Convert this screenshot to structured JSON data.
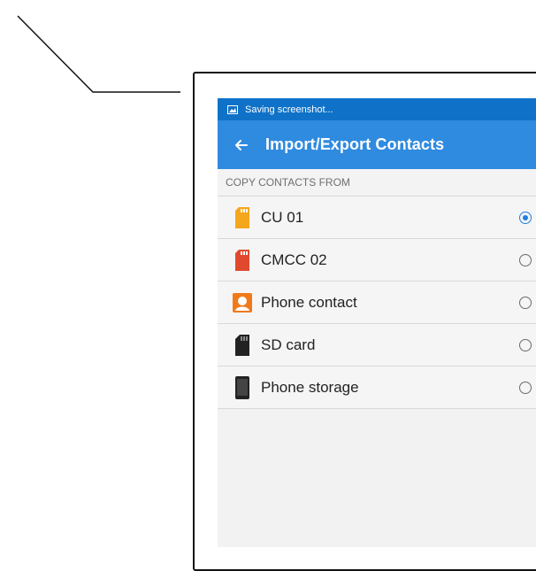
{
  "status_bar": {
    "text": "Saving screenshot..."
  },
  "app_bar": {
    "title": "Import/Export Contacts"
  },
  "section": {
    "title": "COPY CONTACTS FROM"
  },
  "items": [
    {
      "label": "CU 01",
      "icon": "sim-card-yellow-icon",
      "selected": true
    },
    {
      "label": "CMCC 02",
      "icon": "sim-card-red-icon",
      "selected": false
    },
    {
      "label": "Phone contact",
      "icon": "contact-avatar-icon",
      "selected": false
    },
    {
      "label": "SD card",
      "icon": "sd-card-icon",
      "selected": false
    },
    {
      "label": "Phone storage",
      "icon": "phone-storage-icon",
      "selected": false
    }
  ],
  "colors": {
    "status_bar": "#0f72c8",
    "app_bar": "#2f8be0",
    "radio_selected": "#1f7ee0",
    "sim_yellow": "#f4a61c",
    "sim_red": "#e0492e",
    "contact_orange": "#f07a1a"
  }
}
